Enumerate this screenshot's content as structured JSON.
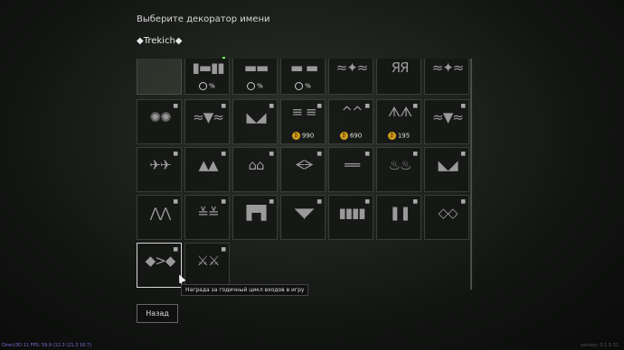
{
  "title": "Выберите декоратор имени",
  "preview_name": "◆Trekich◆",
  "cells": [
    {
      "emblem": "",
      "empty": true,
      "locked": false
    },
    {
      "emblem": "▮▬▮▮",
      "timer": "%",
      "locked": false
    },
    {
      "emblem": "▬▬",
      "timer": "%",
      "locked": false
    },
    {
      "emblem": "▬ ▬",
      "timer": "%",
      "locked": false
    },
    {
      "emblem": "≈✦≈",
      "locked": true
    },
    {
      "emblem": "ЯЯ",
      "locked": true
    },
    {
      "emblem": "≈✦≈",
      "locked": true
    },
    {
      "emblem": "✺✺",
      "locked": true
    },
    {
      "emblem": "≈▼≈",
      "locked": true
    },
    {
      "emblem": "◣◢",
      "locked": true
    },
    {
      "emblem": "≡ ≡",
      "cost": "990",
      "locked": true
    },
    {
      "emblem": "^^",
      "cost": "690",
      "locked": true
    },
    {
      "emblem": "ᗑᗑ",
      "cost": "195",
      "locked": true
    },
    {
      "emblem": "≈▼≈",
      "locked": true
    },
    {
      "emblem": "✈✈",
      "locked": true
    },
    {
      "emblem": "▲▲",
      "locked": true
    },
    {
      "emblem": "⌂⌂",
      "locked": true
    },
    {
      "emblem": "ᗕᗒ",
      "locked": true
    },
    {
      "emblem": "══",
      "locked": true
    },
    {
      "emblem": "♨♨",
      "locked": true
    },
    {
      "emblem": "◣◢",
      "locked": true
    },
    {
      "emblem": "⋀⋀",
      "locked": true
    },
    {
      "emblem": "≚≚",
      "locked": true
    },
    {
      "emblem": "▛▜",
      "locked": true
    },
    {
      "emblem": "◥◤",
      "locked": true
    },
    {
      "emblem": "▮▮▮▮",
      "locked": true
    },
    {
      "emblem": "❚❚",
      "locked": true
    },
    {
      "emblem": "◇◇",
      "locked": true
    },
    {
      "emblem": "◆>◆",
      "locked": true,
      "selected": true
    },
    {
      "emblem": "⚔⚔",
      "locked": true
    }
  ],
  "coin_symbol": "₿",
  "lock_symbol": "🔒",
  "tooltip": "Награда за годичный цикл входов в игру",
  "back_button": "Назад",
  "fps_text": "Direct3D 11 FPS: 59.9 (12.3 (21.3 16.7)",
  "version": "version: 0.1.5.31"
}
